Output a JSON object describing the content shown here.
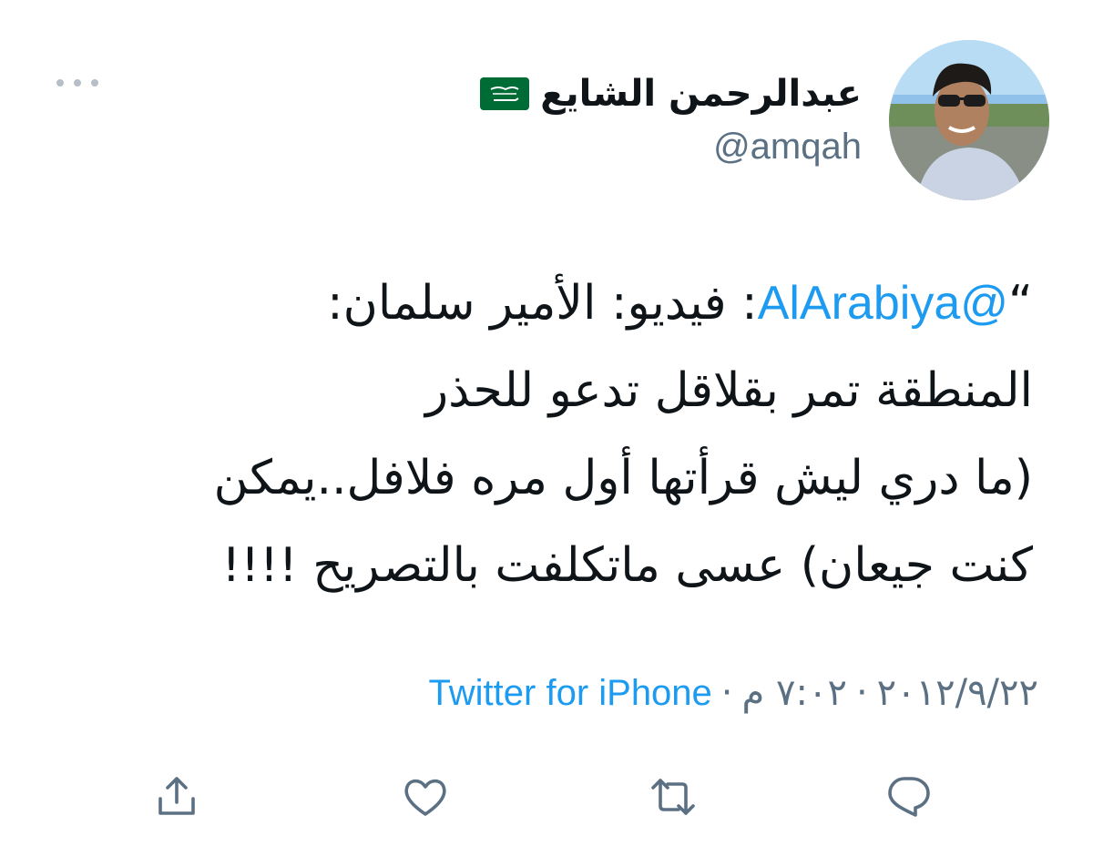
{
  "tweet": {
    "display_name": "عبدالرحمن الشايع",
    "flag_icon": "saudi-flag-emoji",
    "handle": "@amqah",
    "body_lines": [
      {
        "prefix": "“",
        "mention": "@AlArabiya",
        "suffix": ": فيديو: الأمير سلمان:"
      },
      {
        "text": "المنطقة تمر بقلاقل تدعو للحذر"
      },
      {
        "text": "(ما دري ليش قرأتها أول مره فلافل..يمكن"
      },
      {
        "text": "كنت جيعان) عسى ماتكلفت بالتصريح !!!!"
      }
    ],
    "date": "٢٠١٢/٩/٢٢",
    "time": "٧:٠٢ م",
    "separator": "·",
    "source": "Twitter for iPhone"
  },
  "actions": [
    {
      "name": "share",
      "icon": "share-icon"
    },
    {
      "name": "like",
      "icon": "heart-icon"
    },
    {
      "name": "retweet",
      "icon": "retweet-icon"
    },
    {
      "name": "reply",
      "icon": "reply-icon"
    }
  ],
  "colors": {
    "link": "#1d9bf0",
    "secondary_text": "#5b7083",
    "icon": "#5b7083",
    "flag_green": "#006c35"
  }
}
